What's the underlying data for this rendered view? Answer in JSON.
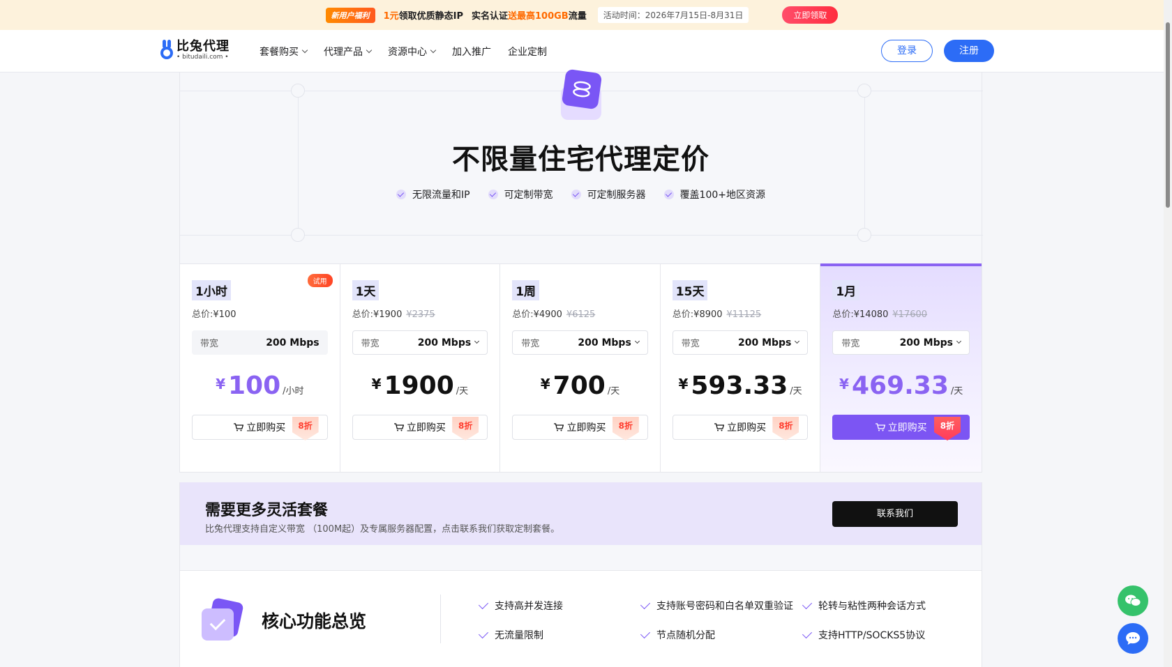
{
  "promo": {
    "tag": "新用户福利",
    "offer_prefix": "1元",
    "offer_text": "领取优质静态IP",
    "verify_text": "实名认证",
    "verify_highlight": "送最高100GB",
    "verify_suffix": "流量",
    "time": "活动时间：2026年7月15日-8月31日",
    "claim": "立即领取"
  },
  "nav": {
    "logo_name": "比兔代理",
    "logo_sub": "• bitudaili.com •",
    "menu": [
      "套餐购买",
      "代理产品",
      "资源中心",
      "加入推广",
      "企业定制"
    ],
    "login": "登录",
    "register": "注册"
  },
  "hero": {
    "title": "不限量住宅代理定价",
    "features": [
      "无限流量和IP",
      "可定制带宽",
      "可定制服务器",
      "覆盖100+地区资源"
    ]
  },
  "plans": [
    {
      "name": "1小时",
      "badge": "试用",
      "total_label": "总价:",
      "total": "¥100",
      "original": "",
      "bw_label": "带宽",
      "bw": "200 Mbps",
      "currency": "¥",
      "price": "100",
      "unit": "/小时",
      "buy": "立即购买",
      "discount": "8折"
    },
    {
      "name": "1天",
      "total_label": "总价:",
      "total": "¥1900",
      "original": "¥2375",
      "bw_label": "带宽",
      "bw": "200 Mbps",
      "currency": "¥",
      "price": "1900",
      "unit": "/天",
      "buy": "立即购买",
      "discount": "8折"
    },
    {
      "name": "1周",
      "total_label": "总价:",
      "total": "¥4900",
      "original": "¥6125",
      "bw_label": "带宽",
      "bw": "200 Mbps",
      "currency": "¥",
      "price": "700",
      "unit": "/天",
      "buy": "立即购买",
      "discount": "8折"
    },
    {
      "name": "15天",
      "total_label": "总价:",
      "total": "¥8900",
      "original": "¥11125",
      "bw_label": "带宽",
      "bw": "200 Mbps",
      "currency": "¥",
      "price": "593.33",
      "unit": "/天",
      "buy": "立即购买",
      "discount": "8折"
    },
    {
      "name": "1月",
      "total_label": "总价:",
      "total": "¥14080",
      "original": "¥17600",
      "bw_label": "带宽",
      "bw": "200 Mbps",
      "currency": "¥",
      "price": "469.33",
      "unit": "/天",
      "buy": "立即购买",
      "discount": "8折"
    }
  ],
  "custom": {
    "title": "需要更多灵活套餐",
    "subtitle": "比兔代理支持自定义带宽 （100M起）及专属服务器配置，点击联系我们获取定制套餐。",
    "contact": "联系我们"
  },
  "core": {
    "title": "核心功能总览",
    "items": [
      "支持高并发连接",
      "支持账号密码和白名单双重验证",
      "轮转与粘性两种会话方式",
      "无流量限制",
      "节点随机分配",
      "支持HTTP/SOCKS5协议"
    ]
  },
  "colors": {
    "accent": "#7c55f3",
    "brand_blue": "#2c6cf6",
    "promo_orange": "#ff6a00"
  }
}
